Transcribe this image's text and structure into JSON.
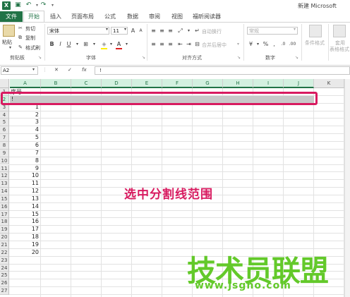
{
  "window": {
    "title": "新建 Microsoft"
  },
  "tabs": [
    "文件",
    "开始",
    "插入",
    "页面布局",
    "公式",
    "数据",
    "审阅",
    "视图",
    "福昕阅读器"
  ],
  "ribbon": {
    "clipboard": {
      "paste": "粘贴",
      "cut": "剪切",
      "copy": "复制",
      "format_painter": "格式刷",
      "label": "剪贴板"
    },
    "font": {
      "name": "宋体",
      "size": "11",
      "bold": "B",
      "italic": "I",
      "underline": "U",
      "font_color": "A",
      "grow": "A",
      "shrink": "A",
      "label": "字体"
    },
    "alignment": {
      "wrap": "自动换行",
      "merge": "合并后居中",
      "label": "对齐方式"
    },
    "number": {
      "format": "常规",
      "percent": "%",
      "comma": ",",
      "label": "数字"
    },
    "styles": {
      "conditional": "条件格式",
      "table": "套用",
      "table2": "表格格式"
    }
  },
  "formula_bar": {
    "name_box": "A2",
    "cancel": "✕",
    "enter": "✓",
    "fx": "fx",
    "content": "!"
  },
  "columns": [
    "A",
    "B",
    "C",
    "D",
    "E",
    "F",
    "G",
    "H",
    "I",
    "J",
    "K"
  ],
  "rows": [
    "1",
    "2",
    "3",
    "4",
    "5",
    "6",
    "7",
    "8",
    "9",
    "10",
    "11",
    "12",
    "13",
    "14",
    "15",
    "16",
    "17",
    "18",
    "19",
    "20",
    "21",
    "22",
    "23",
    "24",
    "25",
    "26",
    "27"
  ],
  "cells": {
    "A1": "序号",
    "A2": "!",
    "A_values": [
      "1",
      "2",
      "3",
      "4",
      "5",
      "6",
      "7",
      "8",
      "9",
      "10",
      "11",
      "12",
      "13",
      "14",
      "15",
      "16",
      "17",
      "18",
      "19",
      "20"
    ]
  },
  "annotation": "选中分割线范围",
  "watermark": {
    "text": "技术员联盟",
    "url": "www.jsgho.com"
  },
  "colors": {
    "accent": "#217346",
    "highlight": "#d81b60",
    "watermark": "#63c92a"
  }
}
